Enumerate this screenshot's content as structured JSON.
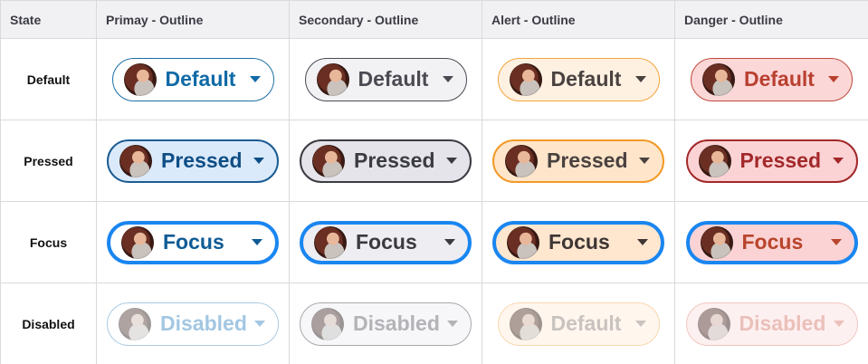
{
  "headers": [
    "State",
    "Primay - Outline",
    "Secondary - Outline",
    "Alert - Outline",
    "Danger - Outline"
  ],
  "rows": [
    {
      "state": "Default",
      "chips": [
        "Default",
        "Default",
        "Default",
        "Default"
      ]
    },
    {
      "state": "Pressed",
      "chips": [
        "Pressed",
        "Pressed",
        "Pressed",
        "Pressed"
      ]
    },
    {
      "state": "Focus",
      "chips": [
        "Focus",
        "Focus",
        "Focus",
        "Focus"
      ]
    },
    {
      "state": "Disabled",
      "chips": [
        "Disabled",
        "Disabled",
        "Default",
        "Disabled"
      ]
    }
  ],
  "colors": {
    "primary": "#1d6fa5",
    "secondary": "#4a4a52",
    "alert": "#f3a33a",
    "danger": "#c0493a",
    "focus_ring": "#1a86f0",
    "header_bg": "#f1f1f4",
    "grid_line": "#d9d9de"
  },
  "icons": {
    "avatar": "user-avatar-photo",
    "caret": "caret-down-icon"
  }
}
